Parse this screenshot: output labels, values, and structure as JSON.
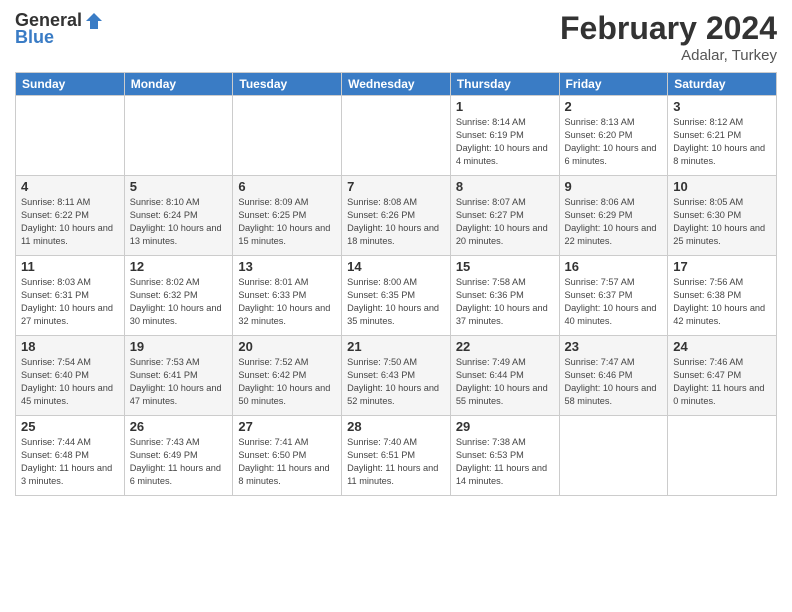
{
  "header": {
    "logo_general": "General",
    "logo_blue": "Blue",
    "month_title": "February 2024",
    "location": "Adalar, Turkey"
  },
  "days_of_week": [
    "Sunday",
    "Monday",
    "Tuesday",
    "Wednesday",
    "Thursday",
    "Friday",
    "Saturday"
  ],
  "weeks": [
    [
      {
        "day": "",
        "info": ""
      },
      {
        "day": "",
        "info": ""
      },
      {
        "day": "",
        "info": ""
      },
      {
        "day": "",
        "info": ""
      },
      {
        "day": "1",
        "info": "Sunrise: 8:14 AM\nSunset: 6:19 PM\nDaylight: 10 hours and 4 minutes."
      },
      {
        "day": "2",
        "info": "Sunrise: 8:13 AM\nSunset: 6:20 PM\nDaylight: 10 hours and 6 minutes."
      },
      {
        "day": "3",
        "info": "Sunrise: 8:12 AM\nSunset: 6:21 PM\nDaylight: 10 hours and 8 minutes."
      }
    ],
    [
      {
        "day": "4",
        "info": "Sunrise: 8:11 AM\nSunset: 6:22 PM\nDaylight: 10 hours and 11 minutes."
      },
      {
        "day": "5",
        "info": "Sunrise: 8:10 AM\nSunset: 6:24 PM\nDaylight: 10 hours and 13 minutes."
      },
      {
        "day": "6",
        "info": "Sunrise: 8:09 AM\nSunset: 6:25 PM\nDaylight: 10 hours and 15 minutes."
      },
      {
        "day": "7",
        "info": "Sunrise: 8:08 AM\nSunset: 6:26 PM\nDaylight: 10 hours and 18 minutes."
      },
      {
        "day": "8",
        "info": "Sunrise: 8:07 AM\nSunset: 6:27 PM\nDaylight: 10 hours and 20 minutes."
      },
      {
        "day": "9",
        "info": "Sunrise: 8:06 AM\nSunset: 6:29 PM\nDaylight: 10 hours and 22 minutes."
      },
      {
        "day": "10",
        "info": "Sunrise: 8:05 AM\nSunset: 6:30 PM\nDaylight: 10 hours and 25 minutes."
      }
    ],
    [
      {
        "day": "11",
        "info": "Sunrise: 8:03 AM\nSunset: 6:31 PM\nDaylight: 10 hours and 27 minutes."
      },
      {
        "day": "12",
        "info": "Sunrise: 8:02 AM\nSunset: 6:32 PM\nDaylight: 10 hours and 30 minutes."
      },
      {
        "day": "13",
        "info": "Sunrise: 8:01 AM\nSunset: 6:33 PM\nDaylight: 10 hours and 32 minutes."
      },
      {
        "day": "14",
        "info": "Sunrise: 8:00 AM\nSunset: 6:35 PM\nDaylight: 10 hours and 35 minutes."
      },
      {
        "day": "15",
        "info": "Sunrise: 7:58 AM\nSunset: 6:36 PM\nDaylight: 10 hours and 37 minutes."
      },
      {
        "day": "16",
        "info": "Sunrise: 7:57 AM\nSunset: 6:37 PM\nDaylight: 10 hours and 40 minutes."
      },
      {
        "day": "17",
        "info": "Sunrise: 7:56 AM\nSunset: 6:38 PM\nDaylight: 10 hours and 42 minutes."
      }
    ],
    [
      {
        "day": "18",
        "info": "Sunrise: 7:54 AM\nSunset: 6:40 PM\nDaylight: 10 hours and 45 minutes."
      },
      {
        "day": "19",
        "info": "Sunrise: 7:53 AM\nSunset: 6:41 PM\nDaylight: 10 hours and 47 minutes."
      },
      {
        "day": "20",
        "info": "Sunrise: 7:52 AM\nSunset: 6:42 PM\nDaylight: 10 hours and 50 minutes."
      },
      {
        "day": "21",
        "info": "Sunrise: 7:50 AM\nSunset: 6:43 PM\nDaylight: 10 hours and 52 minutes."
      },
      {
        "day": "22",
        "info": "Sunrise: 7:49 AM\nSunset: 6:44 PM\nDaylight: 10 hours and 55 minutes."
      },
      {
        "day": "23",
        "info": "Sunrise: 7:47 AM\nSunset: 6:46 PM\nDaylight: 10 hours and 58 minutes."
      },
      {
        "day": "24",
        "info": "Sunrise: 7:46 AM\nSunset: 6:47 PM\nDaylight: 11 hours and 0 minutes."
      }
    ],
    [
      {
        "day": "25",
        "info": "Sunrise: 7:44 AM\nSunset: 6:48 PM\nDaylight: 11 hours and 3 minutes."
      },
      {
        "day": "26",
        "info": "Sunrise: 7:43 AM\nSunset: 6:49 PM\nDaylight: 11 hours and 6 minutes."
      },
      {
        "day": "27",
        "info": "Sunrise: 7:41 AM\nSunset: 6:50 PM\nDaylight: 11 hours and 8 minutes."
      },
      {
        "day": "28",
        "info": "Sunrise: 7:40 AM\nSunset: 6:51 PM\nDaylight: 11 hours and 11 minutes."
      },
      {
        "day": "29",
        "info": "Sunrise: 7:38 AM\nSunset: 6:53 PM\nDaylight: 11 hours and 14 minutes."
      },
      {
        "day": "",
        "info": ""
      },
      {
        "day": "",
        "info": ""
      }
    ]
  ]
}
